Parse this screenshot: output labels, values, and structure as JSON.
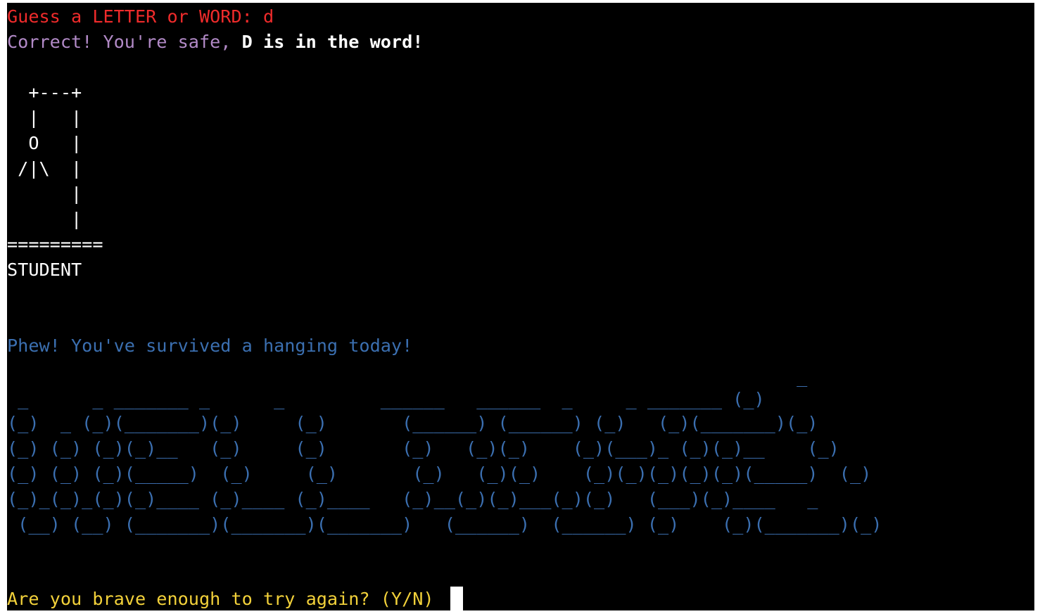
{
  "prompt": {
    "label": "Guess a LETTER or WORD: ",
    "input": "d"
  },
  "feedback": {
    "correct": "Correct! You're safe, ",
    "highlight": "D is in the word!"
  },
  "hangman_art": [
    "  +---+",
    "  |   |",
    "  O   |",
    " /|\\  |",
    "      |",
    "      |",
    "========="
  ],
  "revealed_word": "STUDENT",
  "result_message": "Phew! You've survived a hanging today!",
  "banner_art": [
    "                                                                          _",
    " _      _ _______ _      _         ______   ______  _     _ _______ (_)",
    "(_)  _ (_)(_______)(_)     (_)       (______) (______) (_)   (_)(_______)(_)",
    "(_) (_) (_)(_)__   (_)     (_)       (_)   (_)(_)    (_)(___)_ (_)(_)__    (_)",
    "(_) (_) (_)(_____)  (_)     (_)       (_)   (_)(_)    (_)(_)(_)(_)(_)(_____)  (_)",
    "(_)_(_)_(_)(_)____ (_)____ (_)____   (_)__(_)(_)___(_)(_)   (___)(_)____   _",
    " (__) (__) (_______)(_______)(_______)   (______)  (______) (_)    (_)(_______)(_)"
  ],
  "replay_prompt": "Are you brave enough to try again? (Y/N) ",
  "colors": {
    "background": "#000000",
    "prompt": "#ef2b2b",
    "feedback": "#b28ac7",
    "result": "#3b6fb0",
    "replay": "#f2d13a",
    "text": "#ffffff"
  }
}
